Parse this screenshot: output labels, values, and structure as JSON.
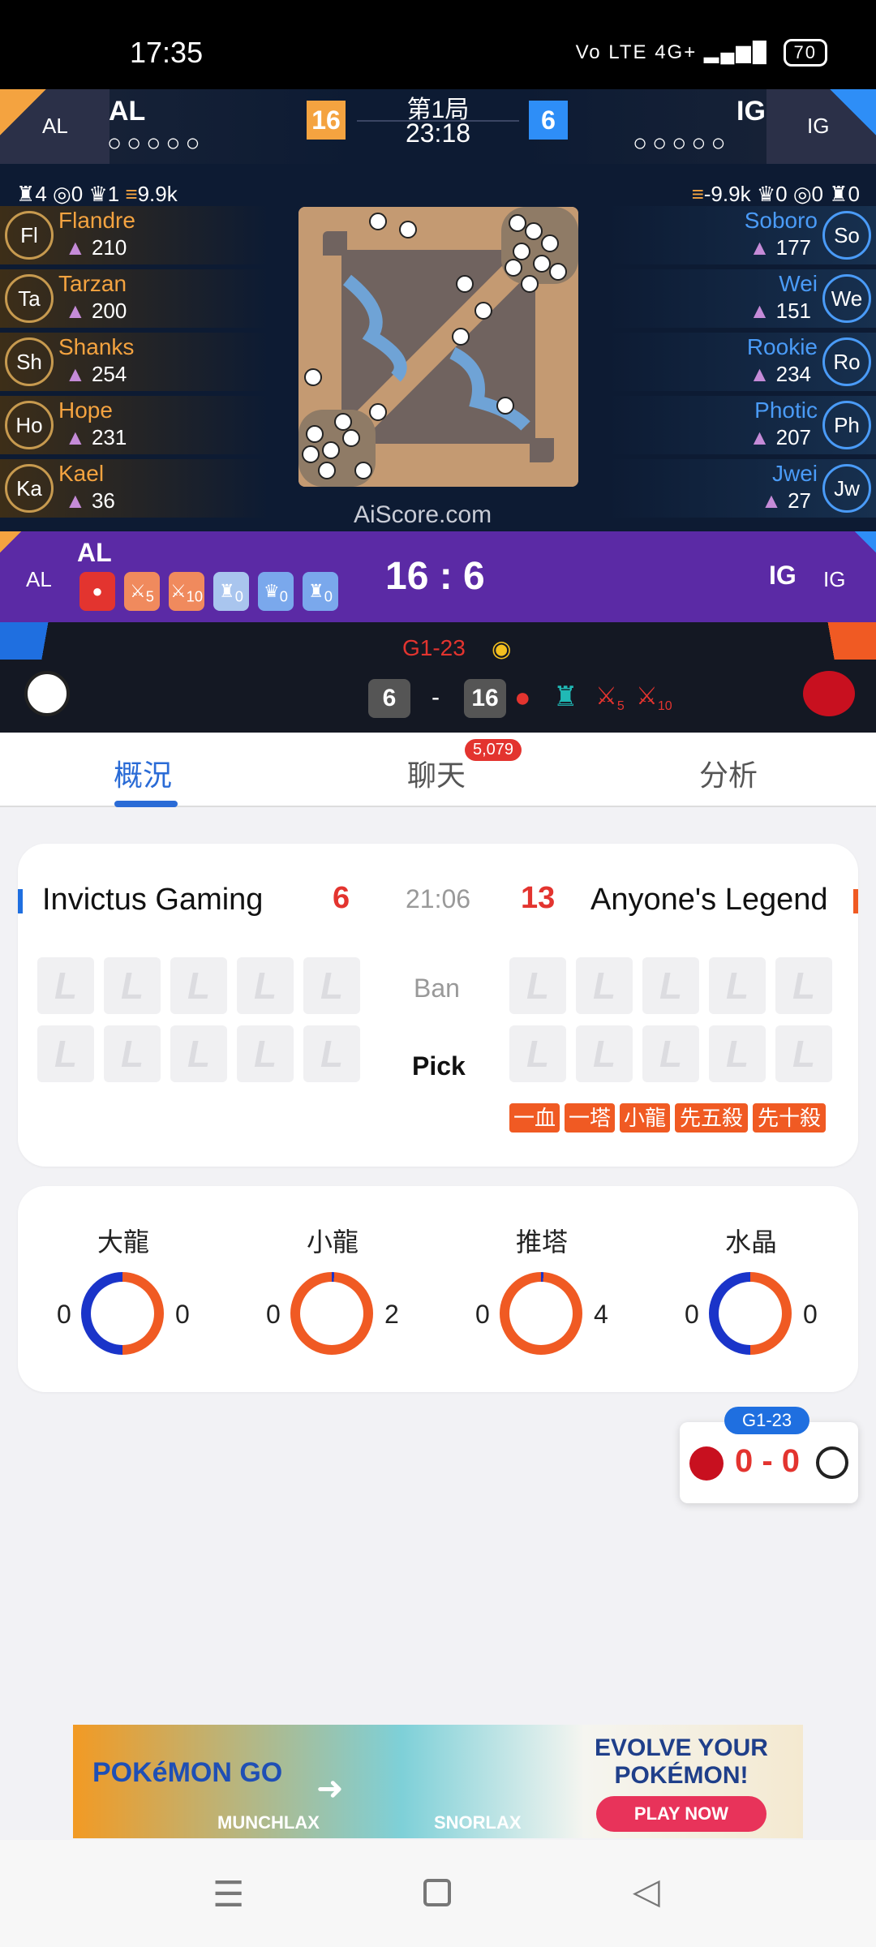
{
  "status_bar": {
    "time": "17:35",
    "network": "Vo LTE 4G+",
    "battery": "70"
  },
  "live": {
    "left_team": {
      "tag": "AL",
      "name": "AL",
      "stats": [
        "4",
        "0",
        "1",
        "9.9k"
      ]
    },
    "right_team": {
      "tag": "IG",
      "name": "IG",
      "stats": [
        "-9.9k",
        "0",
        "0",
        "0"
      ]
    },
    "score_left": "16",
    "score_right": "6",
    "game_label": "第1局",
    "game_time": "23:18",
    "left_players": [
      {
        "abbr": "Fl",
        "name": "Flandre",
        "value": "210"
      },
      {
        "abbr": "Ta",
        "name": "Tarzan",
        "value": "200"
      },
      {
        "abbr": "Sh",
        "name": "Shanks",
        "value": "254"
      },
      {
        "abbr": "Ho",
        "name": "Hope",
        "value": "231"
      },
      {
        "abbr": "Ka",
        "name": "Kael",
        "value": "36"
      }
    ],
    "right_players": [
      {
        "abbr": "So",
        "name": "Soboro",
        "value": "177"
      },
      {
        "abbr": "We",
        "name": "Wei",
        "value": "151"
      },
      {
        "abbr": "Ro",
        "name": "Rookie",
        "value": "234"
      },
      {
        "abbr": "Ph",
        "name": "Photic",
        "value": "207"
      },
      {
        "abbr": "Jw",
        "name": "Jwei",
        "value": "27"
      }
    ],
    "watermark": "AiScore.com"
  },
  "purple_bar": {
    "left_tag": "AL",
    "left_name": "AL",
    "score": "16 : 6",
    "right_name": "IG",
    "right_tag": "IG",
    "objective_counts": [
      "",
      "5",
      "10",
      "0",
      "0",
      "0"
    ]
  },
  "bottom_bar": {
    "label": "G1-23",
    "left_badge": "6",
    "dash": "-",
    "right_badge": "16",
    "sup1": "5",
    "sup2": "10"
  },
  "tabs": [
    {
      "label": "概況"
    },
    {
      "label": "聊天",
      "badge": "5,079"
    },
    {
      "label": "分析"
    }
  ],
  "match_card": {
    "team_left": "Invictus Gaming",
    "score_left": "6",
    "time": "21:06",
    "score_right": "13",
    "team_right": "Anyone's Legend",
    "ban_label": "Ban",
    "pick_label": "Pick",
    "slot_glyph": "L",
    "tags": [
      "一血",
      "一塔",
      "小龍",
      "先五殺",
      "先十殺"
    ]
  },
  "stats_card": [
    {
      "title": "大龍",
      "left": "0",
      "right": "0"
    },
    {
      "title": "小龍",
      "left": "0",
      "right": "2"
    },
    {
      "title": "推塔",
      "left": "0",
      "right": "4"
    },
    {
      "title": "水晶",
      "left": "0",
      "right": "0"
    }
  ],
  "float_score": {
    "tag": "G1-23",
    "score": "0 - 0"
  },
  "ad": {
    "brand": "POKéMON GO",
    "left_name": "MUNCHLAX",
    "right_name": "SNORLAX",
    "headline": "EVOLVE YOUR POKÉMON!",
    "cta": "PLAY NOW"
  },
  "colors": {
    "accent": "#2a6bd6",
    "red": "#e3342f",
    "orange": "#f05a23",
    "purple": "#5b2aa5"
  }
}
